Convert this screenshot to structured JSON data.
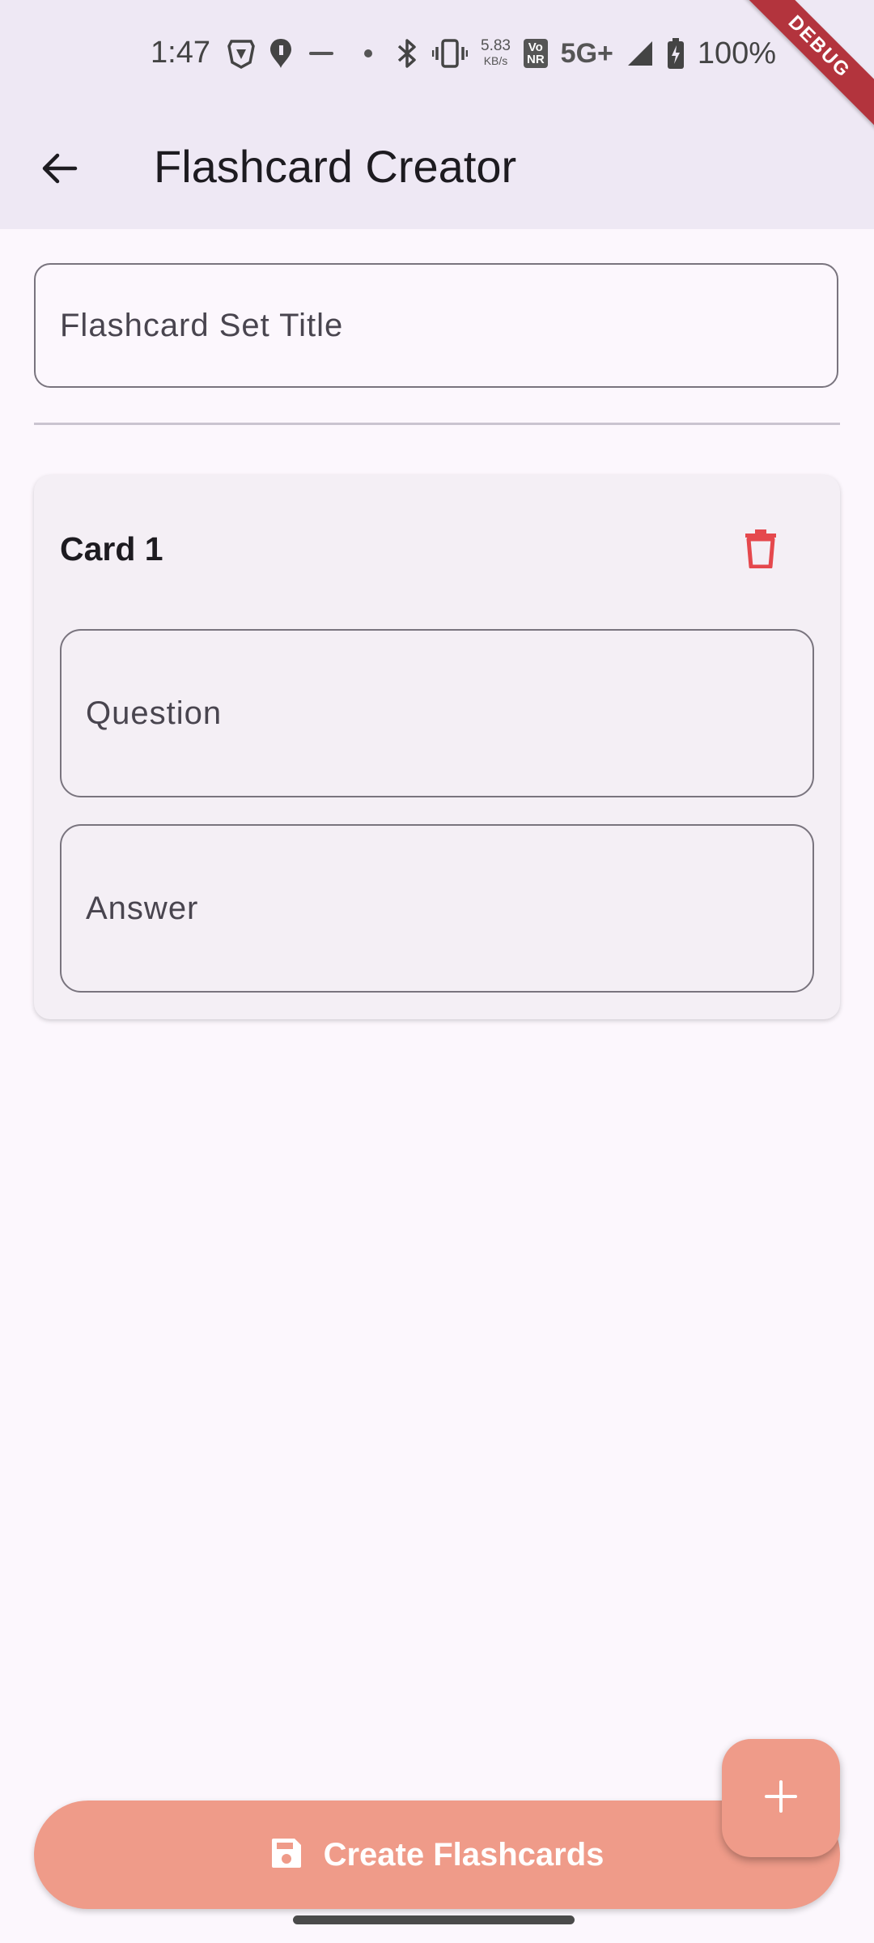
{
  "status_bar": {
    "time": "1:47",
    "net_speed_value": "5.83",
    "net_speed_unit": "KB/s",
    "volte_line1": "Vo",
    "volte_line2": "NR",
    "network_type": "5G+",
    "battery_percent": "100%",
    "icons": [
      "brave-icon",
      "swiggy-icon",
      "rapido-icon",
      "dot-icon",
      "bluetooth-icon",
      "vibrate-icon",
      "signal-icon",
      "battery-charging-icon"
    ]
  },
  "debug_banner": "DEBUG",
  "app_bar": {
    "title": "Flashcard Creator",
    "back_icon": "arrow-back-icon"
  },
  "form": {
    "set_title_placeholder": "Flashcard Set Title",
    "set_title_value": ""
  },
  "cards": [
    {
      "title": "Card 1",
      "question_placeholder": "Question",
      "answer_placeholder": "Answer",
      "delete_icon": "trash-icon"
    }
  ],
  "actions": {
    "create_label": "Create Flashcards",
    "create_icon": "save-icon",
    "fab_icon": "plus-icon"
  },
  "colors": {
    "accent": "#ef9b89",
    "delete": "#e5484d",
    "top_band": "#eee8f4",
    "background": "#fcf7fd",
    "card": "#f4eff5",
    "debug_ribbon": "#b3343d"
  }
}
